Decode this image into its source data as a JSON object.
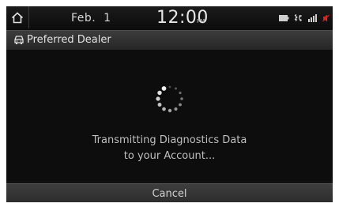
{
  "status_bar": {
    "date": "Feb.  1",
    "time": "12:00",
    "ampm": "PM",
    "icons": [
      "battery-icon",
      "bluetooth-phone-icon",
      "signal-icon",
      "mute-icon"
    ]
  },
  "header": {
    "title": "Preferred Dealer",
    "icon": "car-service-icon"
  },
  "dialog": {
    "message_line1": "Transmitting Diagnostics Data",
    "message_line2": "to your Account...",
    "cancel_label": "Cancel"
  },
  "colors": {
    "background": "#111111",
    "alert_icon": "#e02020"
  }
}
